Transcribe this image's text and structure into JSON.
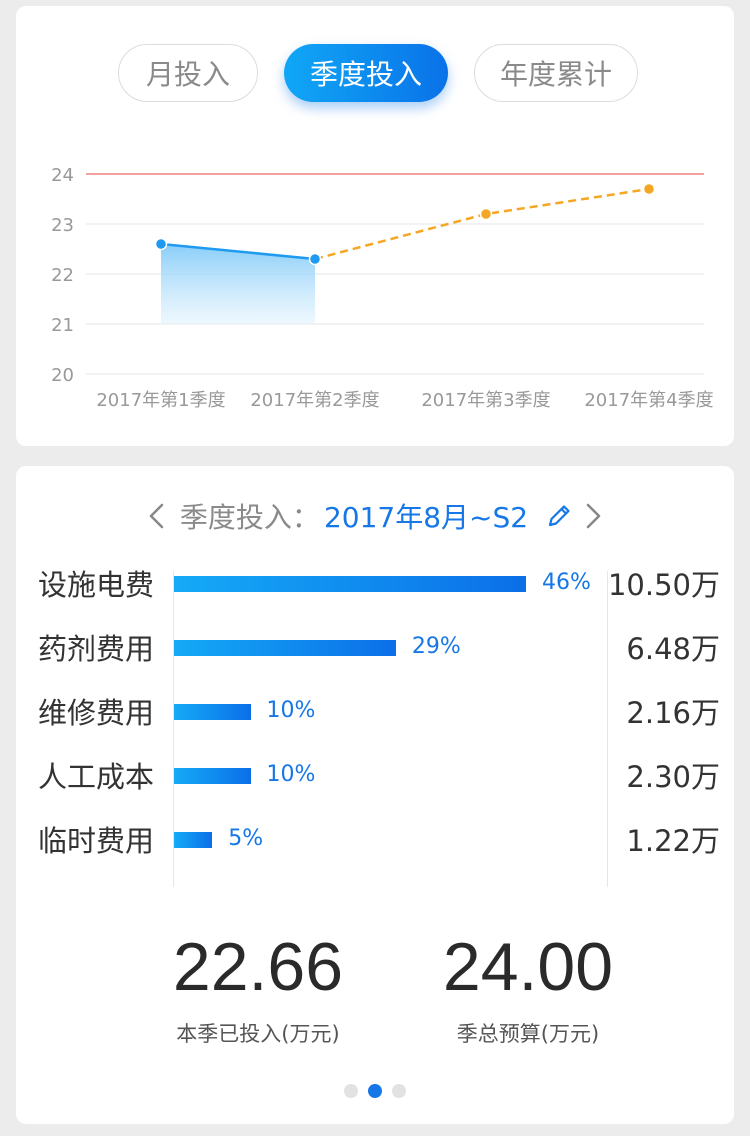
{
  "tabs": [
    {
      "label": "月投入",
      "active": false
    },
    {
      "label": "季度投入",
      "active": true
    },
    {
      "label": "年度累计",
      "active": false
    }
  ],
  "chart_data": {
    "type": "line",
    "categories": [
      "2017年第1季度",
      "2017年第2季度",
      "2017年第3季度",
      "2017年第4季度"
    ],
    "series": [
      {
        "values": [
          22.6,
          22.3,
          null,
          null
        ],
        "color": "#1e9bf0",
        "style": "solid-area"
      },
      {
        "values": [
          null,
          22.3,
          23.2,
          23.7
        ],
        "color": "#f5a623",
        "style": "dashed"
      }
    ],
    "reference_line": {
      "value": 24,
      "color": "#e0463a"
    },
    "ylim": [
      20,
      24
    ],
    "yticks": [
      20,
      21,
      22,
      23,
      24
    ],
    "grid": true
  },
  "period": {
    "label": "季度投入：",
    "value": "2017年8月~S2"
  },
  "breakdown": [
    {
      "label": "设施电费",
      "percent": 46,
      "percent_text": "46%",
      "amount": "10.50万"
    },
    {
      "label": "药剂费用",
      "percent": 29,
      "percent_text": "29%",
      "amount": "6.48万"
    },
    {
      "label": "维修费用",
      "percent": 10,
      "percent_text": "10%",
      "amount": "2.16万"
    },
    {
      "label": "人工成本",
      "percent": 10,
      "percent_text": "10%",
      "amount": "2.30万"
    },
    {
      "label": "临时费用",
      "percent": 5,
      "percent_text": "5%",
      "amount": "1.22万"
    }
  ],
  "summary": {
    "invested": {
      "value": "22.66",
      "caption": "本季已投入(万元)"
    },
    "budget": {
      "value": "24.00",
      "caption": "季总预算(万元)"
    }
  },
  "pagination": {
    "count": 3,
    "active": 1
  },
  "colors": {
    "accent": "#1677e6",
    "forecast": "#f5a623",
    "limit": "#e0463a"
  },
  "icons": {
    "prev": "chevron-left-icon",
    "next": "chevron-right-icon",
    "edit": "pencil-icon"
  }
}
